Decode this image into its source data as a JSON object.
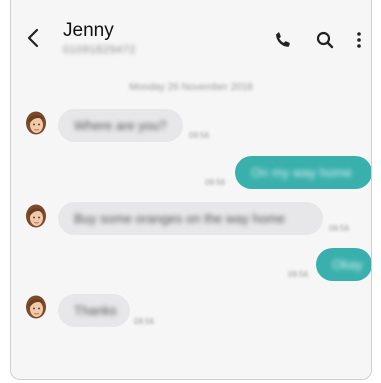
{
  "header": {
    "title": "Jenny",
    "subtitle": "01091829472",
    "back_icon": "chevron-left-icon",
    "phone_icon": "phone-icon",
    "search_icon": "search-icon",
    "more_icon": "more-vertical-icon"
  },
  "conversation": {
    "date": "Monday 26 November 2018",
    "messages": [
      {
        "direction": "in",
        "text": "Where are you?",
        "time": "09:56"
      },
      {
        "direction": "out",
        "text": "On my way home",
        "time": "09:56"
      },
      {
        "direction": "in",
        "text": "Buy some oranges on the way home",
        "time": "09:56"
      },
      {
        "direction": "out",
        "text": "Okay",
        "time": "09:56"
      },
      {
        "direction": "in",
        "text": "Thanks",
        "time": "09:56"
      }
    ]
  },
  "colors": {
    "incoming_bubble": "#e7e7ea",
    "outgoing_bubble": "#3ab0ad",
    "background": "#f6f6f7"
  }
}
